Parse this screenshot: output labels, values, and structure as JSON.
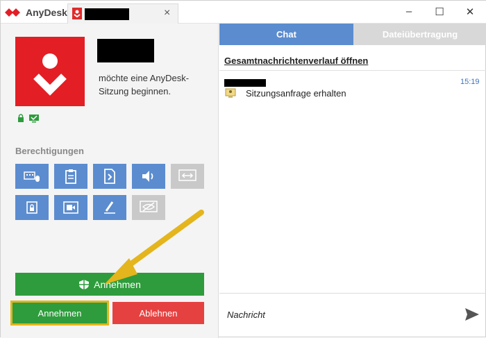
{
  "titlebar": {
    "app_name": "AnyDesk",
    "tab_close": "×",
    "minimize": "–",
    "maximize": "☐",
    "close": "✕"
  },
  "request": {
    "message": "möchte eine AnyDesk-Sitzung beginnen."
  },
  "permissions": {
    "title": "Berechtigungen",
    "items": [
      {
        "name": "keyboard-mouse-icon",
        "enabled": true
      },
      {
        "name": "clipboard-icon",
        "enabled": true
      },
      {
        "name": "file-manager-icon",
        "enabled": true
      },
      {
        "name": "sound-icon",
        "enabled": true
      },
      {
        "name": "control-switch-icon",
        "enabled": false
      },
      {
        "name": "lock-account-icon",
        "enabled": true
      },
      {
        "name": "record-session-icon",
        "enabled": true
      },
      {
        "name": "draw-icon",
        "enabled": true
      },
      {
        "name": "privacy-mode-icon",
        "enabled": false
      }
    ]
  },
  "buttons": {
    "accept_big": "Annehmen",
    "accept": "Annehmen",
    "reject": "Ablehnen"
  },
  "chat": {
    "tab_chat": "Chat",
    "tab_files": "Dateiübertragung",
    "history_link": "Gesamtnachrichtenverlauf öffnen",
    "messages": [
      {
        "time": "15:19",
        "text": "Sitzungsanfrage erhalten"
      }
    ],
    "input_placeholder": "Nachricht"
  },
  "colors": {
    "brand": "#e31e25",
    "accent": "#5b8ccf",
    "accept": "#2e9c3c",
    "reject": "#e64141",
    "highlight": "#e4b51c"
  }
}
